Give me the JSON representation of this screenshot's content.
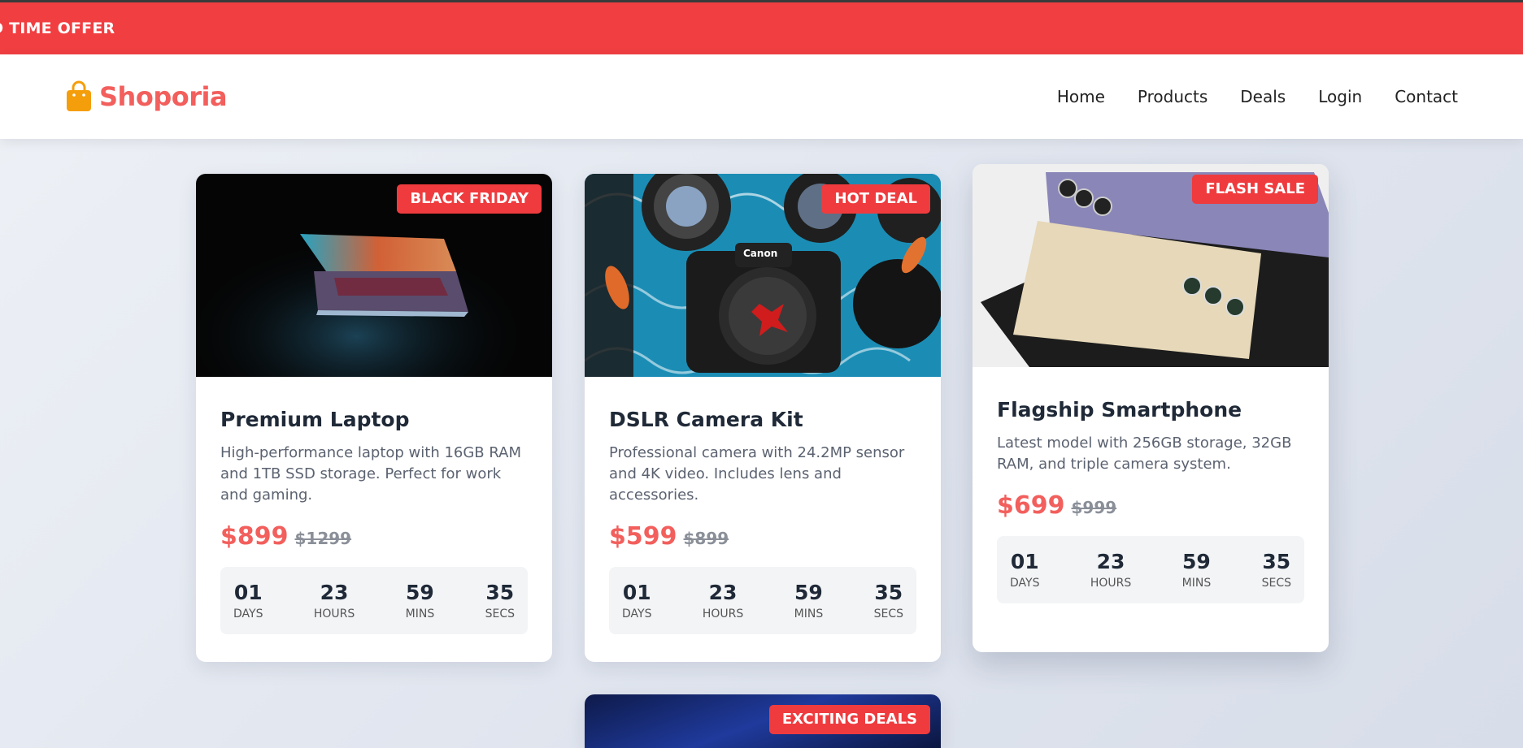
{
  "ticker": {
    "text": "TED TIME OFFER"
  },
  "brand": {
    "name": "Shoporia"
  },
  "nav": [
    "Home",
    "Products",
    "Deals",
    "Login",
    "Contact"
  ],
  "colors": {
    "accent": "#f25f5c",
    "badge": "#ef3b3e",
    "ticker": "#f03e41"
  },
  "products": [
    {
      "badge": "BLACK FRIDAY",
      "title": "Premium Laptop",
      "description": "High-performance laptop with 16GB RAM and 1TB SSD storage. Perfect for work and gaming.",
      "price": "$899",
      "old_price": "$1299",
      "countdown": [
        {
          "value": "01",
          "label": "DAYS"
        },
        {
          "value": "23",
          "label": "HOURS"
        },
        {
          "value": "59",
          "label": "MINS"
        },
        {
          "value": "35",
          "label": "SECS"
        }
      ]
    },
    {
      "badge": "HOT DEAL",
      "title": "DSLR Camera Kit",
      "description": "Professional camera with 24.2MP sensor and 4K video. Includes lens and accessories.",
      "price": "$599",
      "old_price": "$899",
      "countdown": [
        {
          "value": "01",
          "label": "DAYS"
        },
        {
          "value": "23",
          "label": "HOURS"
        },
        {
          "value": "59",
          "label": "MINS"
        },
        {
          "value": "35",
          "label": "SECS"
        }
      ]
    },
    {
      "badge": "FLASH SALE",
      "title": "Flagship Smartphone",
      "description": "Latest model with 256GB storage, 32GB RAM, and triple camera system.",
      "price": "$699",
      "old_price": "$999",
      "countdown": [
        {
          "value": "01",
          "label": "DAYS"
        },
        {
          "value": "23",
          "label": "HOURS"
        },
        {
          "value": "59",
          "label": "MINS"
        },
        {
          "value": "35",
          "label": "SECS"
        }
      ]
    },
    {
      "badge": "EXCITING DEALS"
    }
  ]
}
